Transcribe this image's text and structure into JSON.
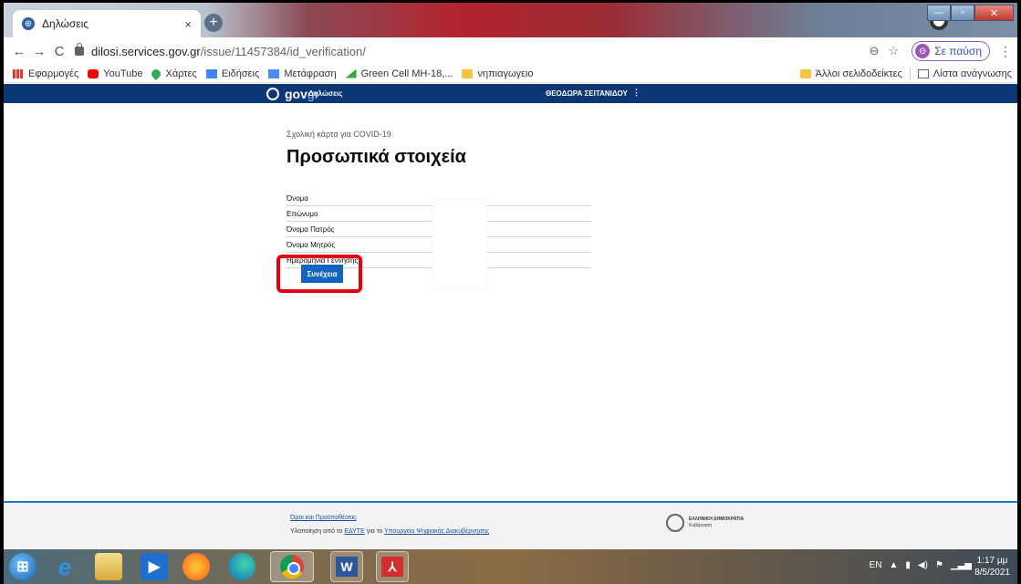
{
  "browser": {
    "tab": {
      "title": "Δηλώσεις",
      "close": "×"
    },
    "new_tab": "+",
    "window_buttons": {
      "minimize": "—",
      "maximize": "▫",
      "close": "✕"
    },
    "nav": {
      "back": "←",
      "forward": "→",
      "reload": "C"
    },
    "url": {
      "host": "dilosi.services.gov.gr",
      "path": "/issue/11457384/id_verification/"
    },
    "zoom_icon": "⊖",
    "star_icon": "☆",
    "pause_button": {
      "avatar": "Θ",
      "label": "Σε παύση"
    },
    "menu": "⋮"
  },
  "bookmarks": {
    "items": [
      {
        "label": "Εφαρμογές",
        "icon": "apps-icon"
      },
      {
        "label": "YouTube",
        "icon": "youtube-icon"
      },
      {
        "label": "Χάρτες",
        "icon": "maps-icon"
      },
      {
        "label": "Ειδήσεις",
        "icon": "news-icon"
      },
      {
        "label": "Μετάφραση",
        "icon": "translate-icon"
      },
      {
        "label": "Green Cell MH-18,...",
        "icon": "greencell-icon"
      },
      {
        "label": "νηπιαγωγειο",
        "icon": "folder-icon"
      }
    ],
    "other": "Άλλοι σελιδοδείκτες",
    "reading_list": "Λίστα ανάγνωσης"
  },
  "site_header": {
    "logo_gov": "gov",
    "logo_gr": "gr",
    "service": "Δηλώσεις",
    "user": "ΘΕΟΔΩΡΑ ΣΕΙΤΑΝΙΔΟΥ",
    "user_menu": "⋮"
  },
  "main": {
    "kicker": "Σχολική κάρτα για COVID-19",
    "title": "Προσωπικά στοιχεία",
    "fields": [
      {
        "label": "Όνομα"
      },
      {
        "label": "Επώνυμο"
      },
      {
        "label": "Όνομα Πατρός"
      },
      {
        "label": "Όνομα Μητρός"
      },
      {
        "label": "Ημερομηνία Γέννησης"
      }
    ],
    "continue": "Συνέχεια"
  },
  "footer": {
    "terms": "Όροι και Προϋποθέσεις",
    "credit_prefix": "Υλοποίηση από το ",
    "credit_link1": "ΕΔΥΤΕ",
    "credit_mid": " για το ",
    "credit_link2": "Υπουργείο Ψηφιακής Διακυβέρνησης",
    "emblem_title": "ΕΛΛΗΝΙΚΗ ΔΗΜΟΚΡΑΤΙΑ",
    "emblem_sub": "Κυβέρνηση"
  },
  "taskbar": {
    "language": "EN",
    "tray_up": "▲",
    "time": "1:17 μμ",
    "date": "8/5/2021",
    "word_label": "W",
    "pdf_label": "⅄"
  },
  "colors": {
    "gov_header": "#0d3674",
    "continue_button": "#1565c0",
    "highlight": "#e3000f",
    "footer_border": "#1a73c8"
  }
}
